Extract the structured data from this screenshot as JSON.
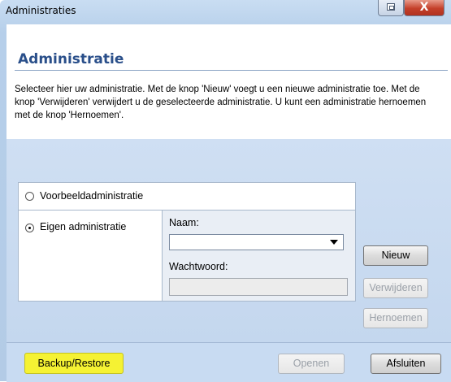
{
  "window": {
    "title": "Administraties",
    "close_glyph": "X",
    "restore_icon": "restore-icon"
  },
  "header": {
    "title": "Administratie",
    "description": "Selecteer hier uw administratie. Met de knop 'Nieuw' voegt u een nieuwe administratie toe. Met de knop 'Verwijderen' verwijdert u de geselecteerde administratie. U kunt een administratie hernoemen met de knop 'Hernoemen'."
  },
  "options": {
    "voorbeeld_label": "Voorbeeldadministratie",
    "voorbeeld_selected": false,
    "eigen_label": "Eigen administratie",
    "eigen_selected": true,
    "naam_label": "Naam:",
    "naam_value": "",
    "wachtwoord_label": "Wachtwoord:",
    "wachtwoord_value": ""
  },
  "buttons": {
    "nieuw": "Nieuw",
    "verwijderen": "Verwijderen",
    "hernoemen": "Hernoemen",
    "backup": "Backup/Restore",
    "openen": "Openen",
    "afsluiten": "Afsluiten"
  },
  "colors": {
    "title_accent": "#2a4f8a",
    "backup_highlight": "#f5f233",
    "panel_background": "#c4d7ee"
  }
}
